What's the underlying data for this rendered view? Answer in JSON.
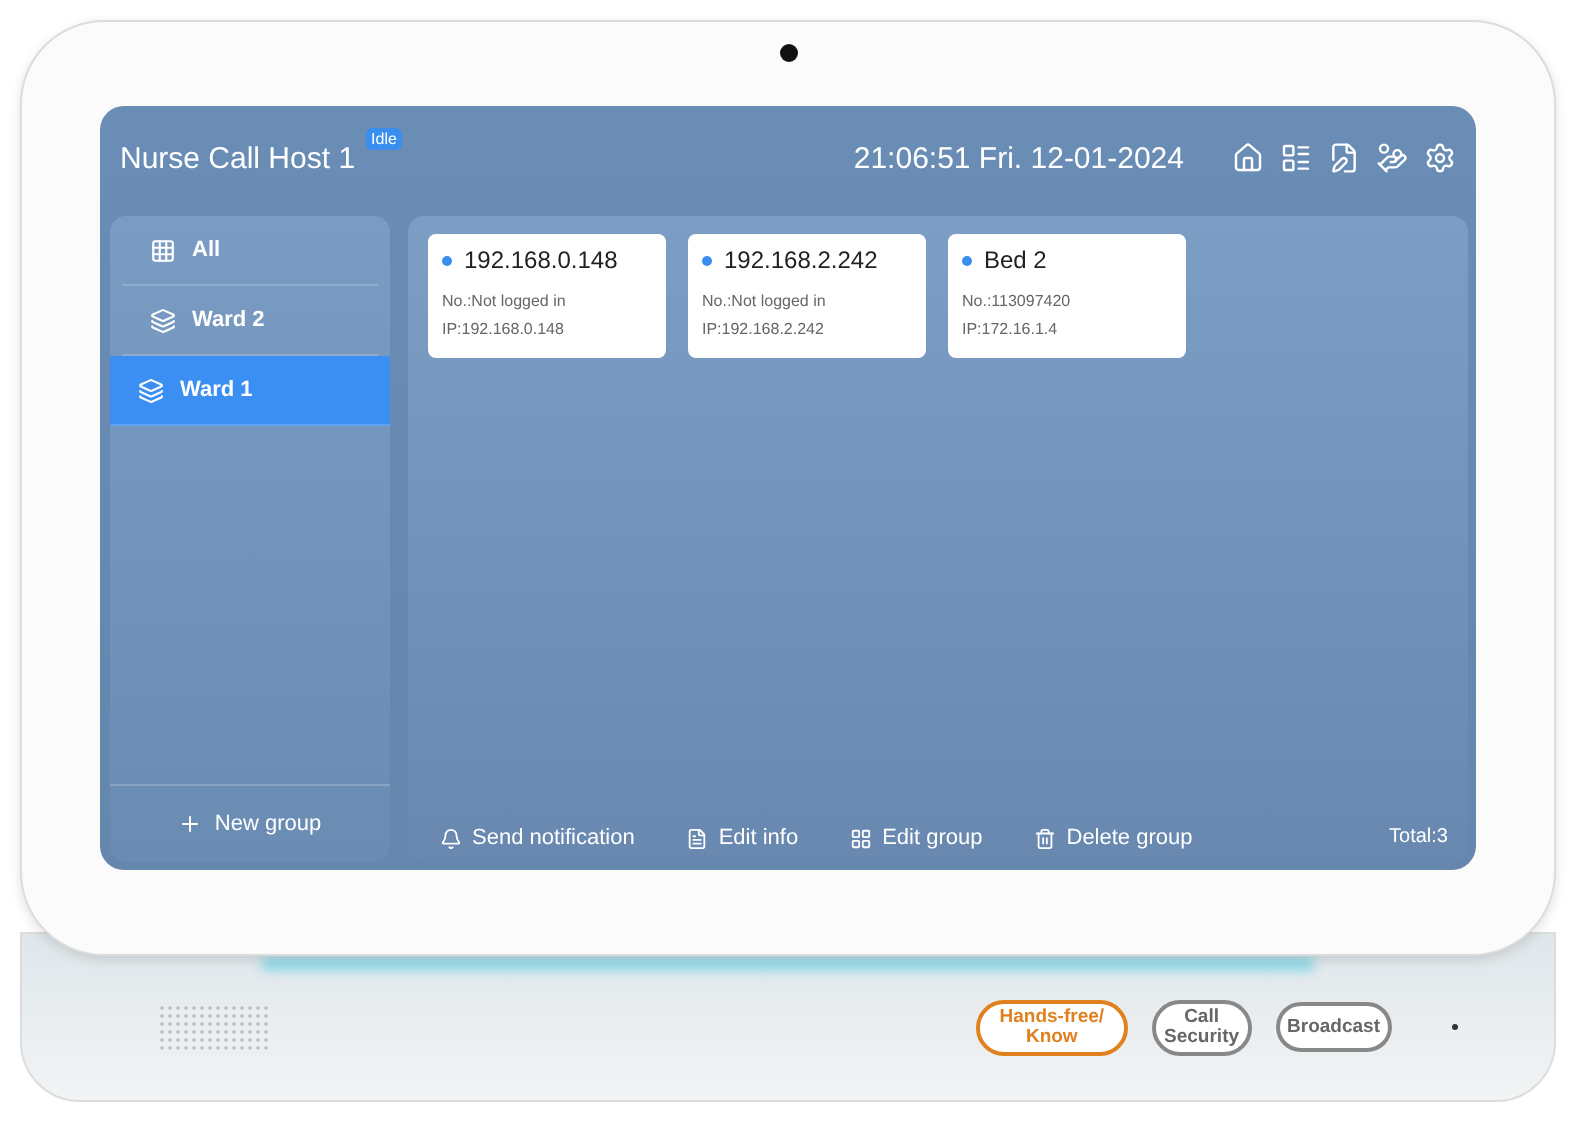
{
  "header": {
    "title": "Nurse Call Host 1",
    "status": "Idle",
    "datetime": "21:06:51 Fri. 12-01-2024"
  },
  "sidebar": {
    "items": [
      {
        "label": "All",
        "kind": "all",
        "selected": false
      },
      {
        "label": "Ward 2",
        "kind": "group",
        "selected": false
      },
      {
        "label": "Ward 1",
        "kind": "group",
        "selected": true
      }
    ],
    "footer": "New group"
  },
  "devices": [
    {
      "name": "192.168.0.148",
      "color": "#3a8ef0",
      "number": "No.:Not logged in",
      "ip": "IP:192.168.0.148"
    },
    {
      "name": "192.168.2.242",
      "color": "#3a8ef0",
      "number": "No.:Not logged in",
      "ip": "IP:192.168.2.242"
    },
    {
      "name": "Bed 2",
      "color": "#3a8ef0",
      "number": "No.:113097420",
      "ip": "IP:172.16.1.4"
    }
  ],
  "actions": [
    {
      "label": "Send notification",
      "kind": "notify"
    },
    {
      "label": "Edit info",
      "kind": "edit_info"
    },
    {
      "label": "Edit group",
      "kind": "edit_group"
    },
    {
      "label": "Delete group",
      "kind": "delete"
    }
  ],
  "total": "Total:3",
  "hardware_buttons": [
    {
      "lines": [
        "Hands-free/",
        "Know"
      ],
      "highlighted": true
    },
    {
      "lines": [
        "Call",
        "Security"
      ],
      "highlighted": false
    },
    {
      "lines": [
        "Broadcast"
      ],
      "highlighted": false
    }
  ]
}
